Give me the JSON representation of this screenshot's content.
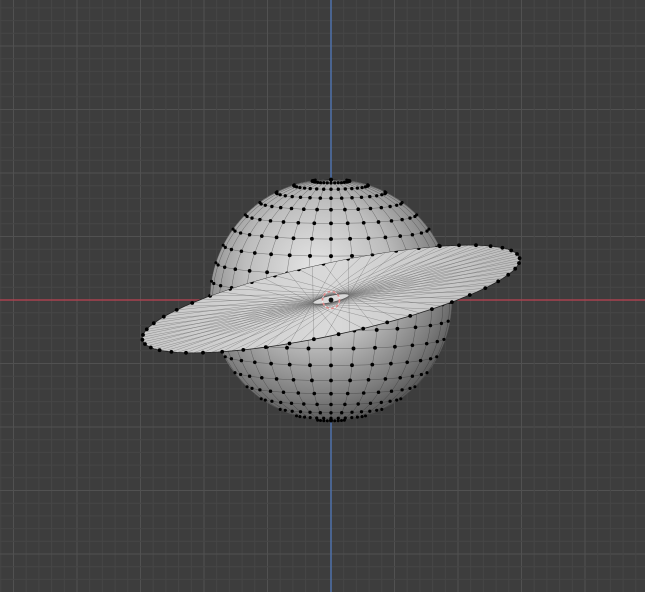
{
  "viewport": {
    "mode": "edit-mode",
    "view": "front-orthographic",
    "colors": {
      "background": "#3d3d3d",
      "grid_minor": "#464646",
      "grid_major": "#515151",
      "x_axis": "#a8424f",
      "z_axis": "#4d6fa5",
      "mesh_fill_light": "#d2d2d2",
      "mesh_fill_dark": "#3a3a3a",
      "vertex": "#000000",
      "edge": "#1a1a1a",
      "origin_ring": "#e08a8a"
    }
  },
  "objects": [
    {
      "name": "uv-sphere",
      "type": "mesh",
      "segments": 32,
      "rings": 20
    },
    {
      "name": "ring-disk",
      "type": "mesh",
      "segments": 48,
      "tilt": "inclined"
    }
  ],
  "cursor": {
    "icon": "3d-cursor-icon"
  }
}
